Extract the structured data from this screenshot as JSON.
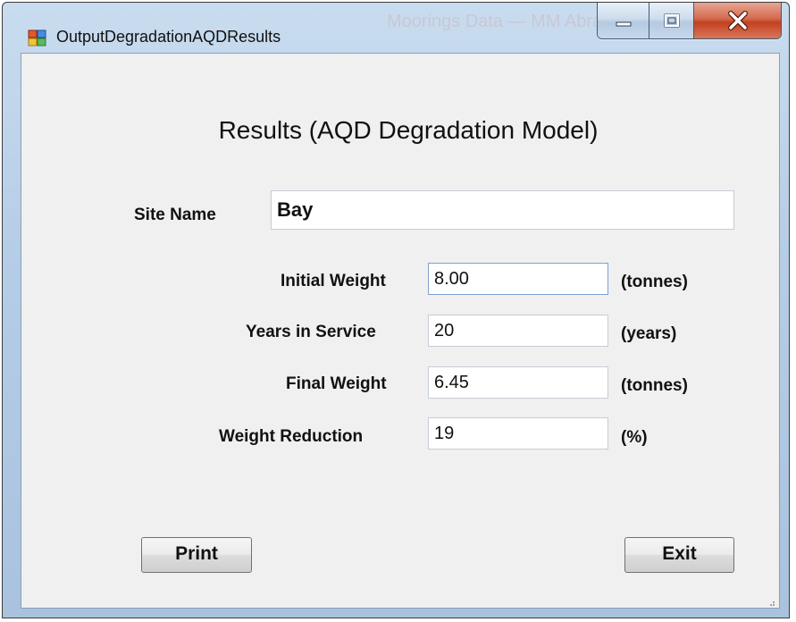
{
  "window": {
    "title": "OutputDegradationAQDResults",
    "background_title": "Moorings Data — MM Abrasion Data"
  },
  "heading": "Results (AQD Degradation Model)",
  "site": {
    "label": "Site Name",
    "value": "Bay"
  },
  "fields": [
    {
      "label": "Initial Weight",
      "value": "8.00",
      "unit": "(tonnes)"
    },
    {
      "label": "Years in Service",
      "value": "20",
      "unit": "(years)"
    },
    {
      "label": "Final Weight",
      "value": "6.45",
      "unit": "(tonnes)"
    },
    {
      "label": "Weight Reduction",
      "value": "19",
      "unit": "(%)"
    }
  ],
  "buttons": {
    "print": "Print",
    "exit": "Exit"
  },
  "colors": {
    "client_bg": "#f0f0f0",
    "close_button": "#c3411f",
    "field_focus_border": "#7da2ce"
  },
  "icons": [
    "app-icon",
    "minimize-icon",
    "maximize-icon",
    "close-icon",
    "resize-grip-icon"
  ]
}
